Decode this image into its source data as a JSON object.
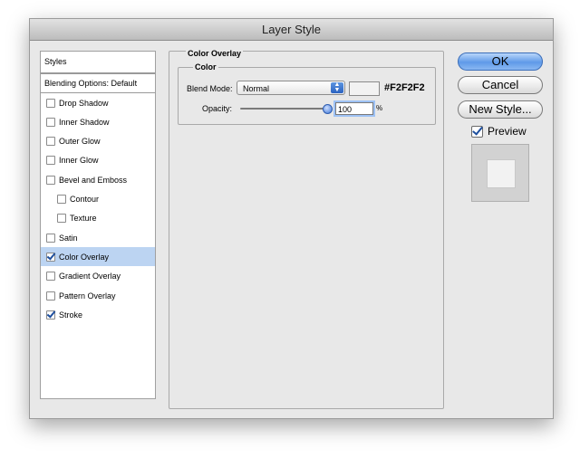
{
  "window": {
    "title": "Layer Style"
  },
  "styles_list": {
    "header": "Styles",
    "blending": "Blending Options: Default",
    "items": [
      {
        "label": "Drop Shadow",
        "checked": false,
        "sub": false,
        "selected": false
      },
      {
        "label": "Inner Shadow",
        "checked": false,
        "sub": false,
        "selected": false
      },
      {
        "label": "Outer Glow",
        "checked": false,
        "sub": false,
        "selected": false
      },
      {
        "label": "Inner Glow",
        "checked": false,
        "sub": false,
        "selected": false
      },
      {
        "label": "Bevel and Emboss",
        "checked": false,
        "sub": false,
        "selected": false
      },
      {
        "label": "Contour",
        "checked": false,
        "sub": true,
        "selected": false
      },
      {
        "label": "Texture",
        "checked": false,
        "sub": true,
        "selected": false
      },
      {
        "label": "Satin",
        "checked": false,
        "sub": false,
        "selected": false
      },
      {
        "label": "Color Overlay",
        "checked": true,
        "sub": false,
        "selected": true
      },
      {
        "label": "Gradient Overlay",
        "checked": false,
        "sub": false,
        "selected": false
      },
      {
        "label": "Pattern Overlay",
        "checked": false,
        "sub": false,
        "selected": false
      },
      {
        "label": "Stroke",
        "checked": true,
        "sub": false,
        "selected": false
      }
    ]
  },
  "color_overlay": {
    "section_title": "Color Overlay",
    "group_title": "Color",
    "blend_mode_label": "Blend Mode:",
    "blend_mode_value": "Normal",
    "color_hex": "#F2F2F2",
    "swatch_color": "#f2f2f2",
    "opacity_label": "Opacity:",
    "opacity_value": "100",
    "opacity_unit": "%",
    "opacity_fraction": 1.0
  },
  "buttons": {
    "ok": "OK",
    "cancel": "Cancel",
    "new_style": "New Style..."
  },
  "preview": {
    "label": "Preview",
    "checked": true
  }
}
